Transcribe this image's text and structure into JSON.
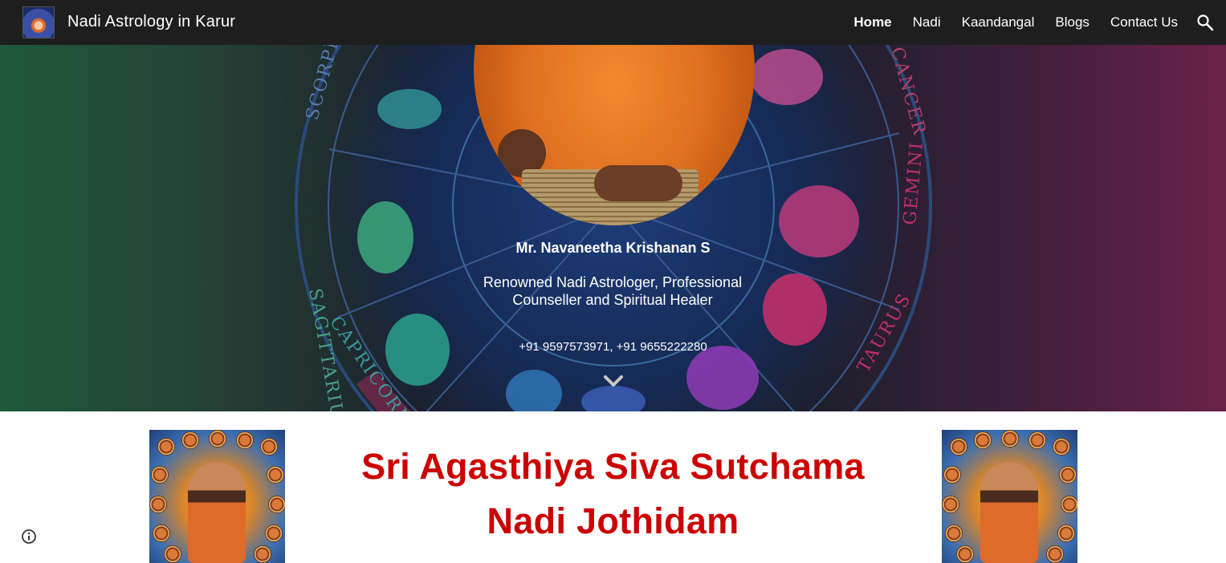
{
  "site": {
    "title": "Nadi Astrology in Karur",
    "logo_icon": "logo-sage-icon"
  },
  "nav": {
    "items": [
      {
        "label": "Home",
        "active": true
      },
      {
        "label": "Nadi",
        "active": false
      },
      {
        "label": "Kaandangal",
        "active": false
      },
      {
        "label": "Blogs",
        "active": false
      },
      {
        "label": "Contact Us",
        "active": false
      }
    ],
    "search_icon": "search-icon"
  },
  "hero": {
    "name": "Mr. Navaneetha Krishanan S",
    "description": "Renowned Nadi Astrologer, Professional Counseller and Spiritual Healer",
    "phone": "+91 9597573971, +91 9655222280",
    "zodiac_labels": [
      "SCORPIO",
      "SAGITTARIUS",
      "CAPRICORN",
      "CANCER",
      "GEMINI",
      "TAURUS"
    ],
    "scroll_icon": "chevron-down-icon"
  },
  "main": {
    "headline_line1": "Sri Agasthiya Siva Sutchama",
    "headline_line2": "Nadi Jothidam"
  },
  "colors": {
    "topbar": "#1e1e1e",
    "headline": "#cc0000",
    "hero_text": "#ffffff"
  },
  "footer": {
    "info_icon": "info-icon"
  }
}
